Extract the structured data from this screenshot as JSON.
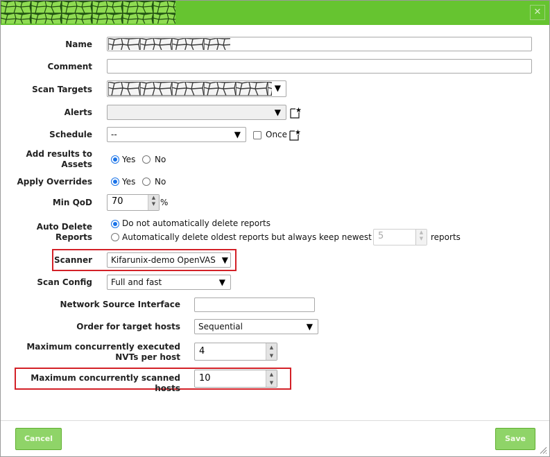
{
  "dialog": {
    "close_icon_glyph": "✕"
  },
  "fields": {
    "name_label": "Name",
    "comment_label": "Comment",
    "scan_targets_label": "Scan Targets",
    "alerts_label": "Alerts",
    "schedule_label": "Schedule",
    "schedule_value": "--",
    "once_label": "Once",
    "add_results_label": "Add results to Assets",
    "apply_overrides_label": "Apply Overrides",
    "yes_label": "Yes",
    "no_label": "No",
    "min_qod_label": "Min QoD",
    "min_qod_value": "70",
    "min_qod_unit": "%",
    "auto_delete_label": "Auto Delete Reports",
    "auto_delete_option1": "Do not automatically delete reports",
    "auto_delete_option2": "Automatically delete oldest reports but always keep newest",
    "auto_delete_keep_value": "5",
    "auto_delete_suffix": "reports",
    "scanner_label": "Scanner",
    "scanner_value": "Kifarunix-demo OpenVAS",
    "scan_config_label": "Scan Config",
    "scan_config_value": "Full and fast",
    "network_source_label": "Network Source Interface",
    "order_hosts_label": "Order for target hosts",
    "order_hosts_value": "Sequential",
    "max_nvts_label": "Maximum concurrently executed NVTs per host",
    "max_nvts_value": "4",
    "max_hosts_label": "Maximum concurrently scanned hosts",
    "max_hosts_value": "10"
  },
  "footer": {
    "cancel_label": "Cancel",
    "save_label": "Save"
  },
  "colors": {
    "brand_green": "#66c430",
    "highlight_red": "#d32027",
    "radio_blue": "#1a73e8"
  }
}
